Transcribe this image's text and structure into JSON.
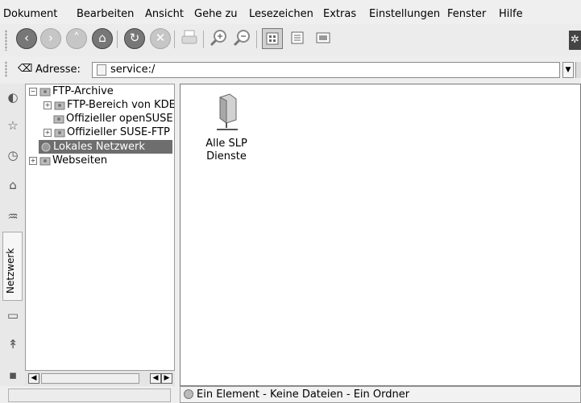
{
  "menubar": {
    "items": [
      {
        "label": "Dokument"
      },
      {
        "label": "Bearbeiten"
      },
      {
        "label": "Ansicht"
      },
      {
        "label": "Gehe zu"
      },
      {
        "label": "Lesezeichen"
      },
      {
        "label": "Extras"
      },
      {
        "label": "Einstellungen"
      },
      {
        "label": "Fenster"
      },
      {
        "label": "Hilfe"
      }
    ]
  },
  "toolbar": {
    "icons": [
      "back-icon",
      "forward-icon",
      "up-icon",
      "home-icon",
      "reload-icon",
      "stop-icon",
      "print-icon",
      "zoom-in-icon",
      "zoom-out-icon",
      "icon-view-icon",
      "detail-view-icon",
      "preview-view-icon"
    ]
  },
  "address": {
    "label": "Adresse:",
    "value": "service:/"
  },
  "sidebar": {
    "active_tab": "Netzwerk"
  },
  "tree": {
    "items": [
      {
        "label": "FTP-Archive",
        "expander": "−"
      },
      {
        "label": "FTP-Bereich von KDE",
        "expander": "+"
      },
      {
        "label": "Offizieller openSUSE"
      },
      {
        "label": "Offizieller SUSE-FTP",
        "expander": "+"
      },
      {
        "label": "Lokales Netzwerk"
      },
      {
        "label": "Webseiten",
        "expander": "+"
      }
    ]
  },
  "main": {
    "items": [
      {
        "label_line1": "Alle SLP",
        "label_line2": "Dienste"
      }
    ]
  },
  "status": {
    "text": "Ein Element - Keine Dateien - Ein Ordner"
  },
  "colors": {
    "selection": "#6e6e6e",
    "background": "#eeeeee"
  }
}
